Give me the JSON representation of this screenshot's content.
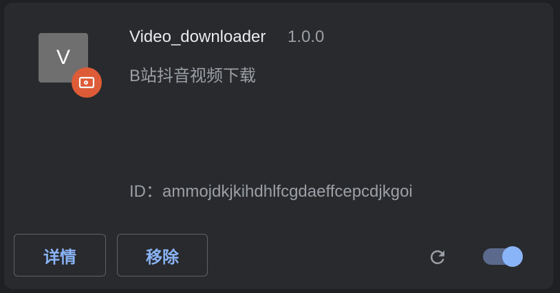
{
  "extension": {
    "icon_letter": "V",
    "name": "Video_downloader",
    "version": "1.0.0",
    "description": "B站抖音视频下载",
    "id_text": "ID：ammojdkjkihdhlfcgdaeffcepcdjkgoi"
  },
  "buttons": {
    "details_label": "详情",
    "remove_label": "移除"
  },
  "toggle": {
    "enabled": true
  },
  "icons": {
    "badge": "unpacked-badge-icon",
    "reload": "reload-icon"
  },
  "colors": {
    "accent": "#8ab4f8",
    "badge": "#dd5b36",
    "card_bg": "#292a2d"
  }
}
